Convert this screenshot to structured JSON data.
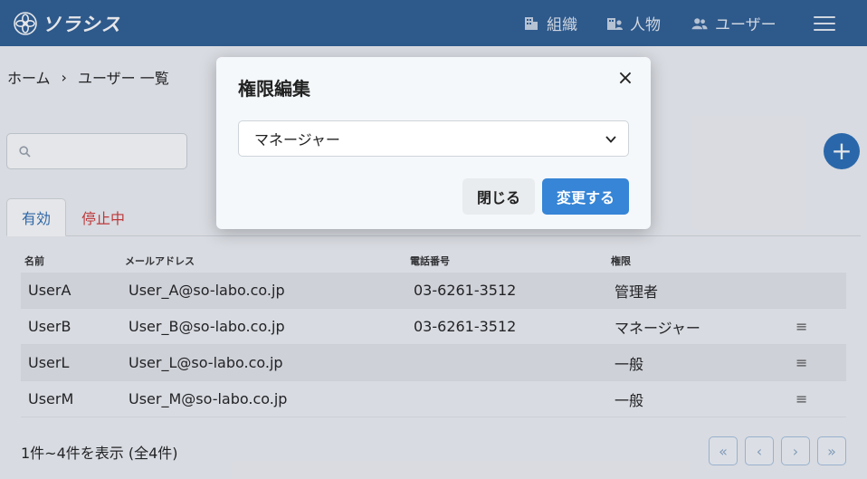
{
  "header": {
    "logo_text": "ソラシス",
    "nav": [
      {
        "label": "組織",
        "icon": "building-icon"
      },
      {
        "label": "人物",
        "icon": "person-building-icon"
      },
      {
        "label": "ユーザー",
        "icon": "users-icon"
      }
    ],
    "menu_icon": "hamburger-menu-icon"
  },
  "breadcrumb": {
    "home": "ホーム",
    "separator": "›",
    "current": "ユーザー 一覧"
  },
  "search": {
    "placeholder": "",
    "value": ""
  },
  "add_button": {
    "label": "+"
  },
  "tabs": {
    "active": "有効",
    "inactive": "停止中"
  },
  "table": {
    "headers": [
      "名前",
      "メールアドレス",
      "電話番号",
      "権限"
    ],
    "rows": [
      {
        "name": "UserA",
        "email": "User_A@so-labo.co.jp",
        "phone": "03-6261-3512",
        "role": "管理者",
        "menu": ""
      },
      {
        "name": "UserB",
        "email": "User_B@so-labo.co.jp",
        "phone": "03-6261-3512",
        "role": "マネージャー",
        "menu": "≡"
      },
      {
        "name": "UserL",
        "email": "User_L@so-labo.co.jp",
        "phone": "",
        "role": "一般",
        "menu": "≡"
      },
      {
        "name": "UserM",
        "email": "User_M@so-labo.co.jp",
        "phone": "",
        "role": "一般",
        "menu": "≡"
      }
    ]
  },
  "footer": {
    "count": "1件~4件を表示 (全4件)"
  },
  "pagination": {
    "first": "«",
    "prev": "‹",
    "next": "›",
    "last": "»"
  },
  "modal": {
    "title": "権限編集",
    "close": "×",
    "select_value": "マネージャー",
    "btn_close": "閉じる",
    "btn_change": "変更する"
  },
  "colors": {
    "header_bg": "#2f5f94",
    "primary": "#3685d6",
    "inactive_tab": "#d23b3b"
  }
}
